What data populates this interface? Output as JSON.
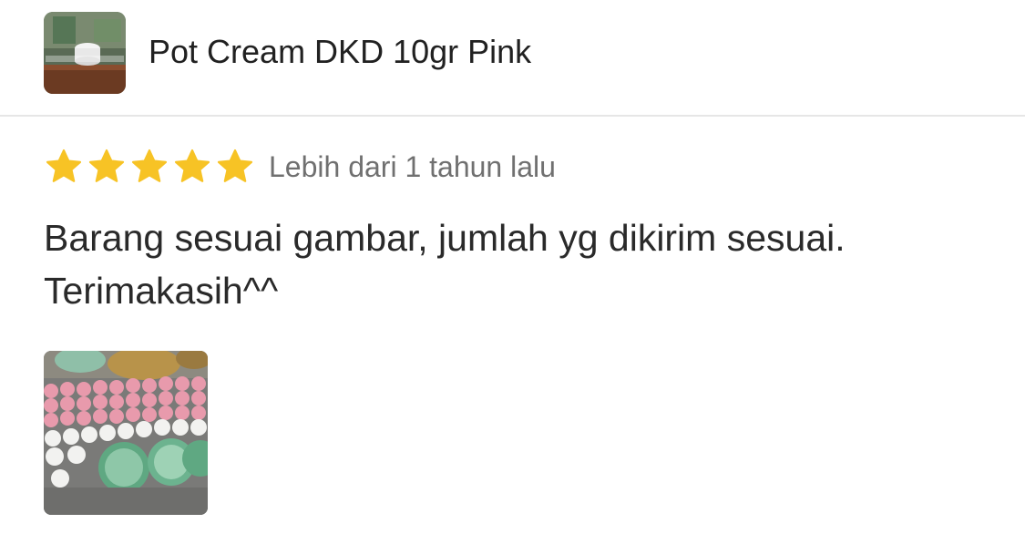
{
  "product": {
    "name": "Pot Cream DKD 10gr Pink",
    "thumbnail_icon": "product-thumbnail-image"
  },
  "review": {
    "rating": 5,
    "max_rating": 5,
    "star_color": "#f7c325",
    "time_ago": "Lebih dari 1 tahun lalu",
    "text_line1": "Barang sesuai gambar, jumlah yg dikirim sesuai.",
    "text_line2": "Terimakasih^^",
    "photo_icon": "review-photo-image"
  }
}
